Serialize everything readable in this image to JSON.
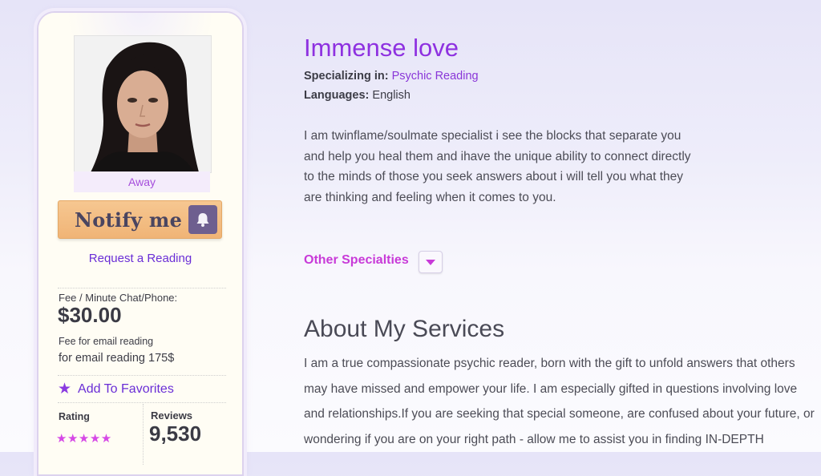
{
  "profile": {
    "status": "Away",
    "notify_label": "Notify me",
    "request_link": "Request a Reading",
    "fee_label": "Fee / Minute Chat/Phone:",
    "fee_value": "$30.00",
    "email_fee_label": "Fee for email reading",
    "email_fee_value": "for email reading 175$",
    "favorites_label": "Add To Favorites",
    "rating_label": "Rating",
    "rating_stars": "★★★★★",
    "rating_value": 5,
    "reviews_label": "Reviews",
    "reviews_value": "9,530"
  },
  "main": {
    "name": "Immense love",
    "specializing_label": "Specializing in:",
    "specializing_value": "Psychic Reading",
    "languages_label": "Languages:",
    "languages_value": "English",
    "bio": "I am twinflame/soulmate specialist i see the blocks that separate you and help you heal them and ihave the unique ability to connect directly to the minds of those you seek answers about i will tell you what they are thinking and feeling when it comes to you.",
    "other_specialties": "Other Specialties",
    "about_title": "About My Services",
    "about_body": "I am a true compassionate psychic reader, born with the gift to unfold answers that others may have missed and empower your life. I am especially gifted in questions involving love and relationships.If you are seeking that special someone, are confused about your future, or wondering if you are on your right path - allow me to assist you in finding IN-DEPTH"
  },
  "colors": {
    "accent_purple": "#8e31e0",
    "link_purple": "#6a2ed6",
    "magenta": "#c83ad8",
    "notify_orange": "#f0b476"
  }
}
